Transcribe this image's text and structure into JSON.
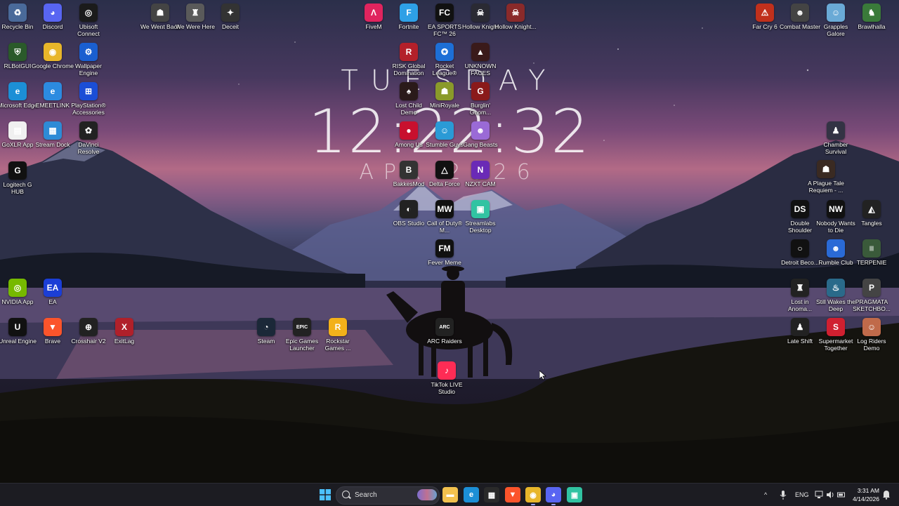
{
  "lock_clock": {
    "day": "TUESDAY",
    "time": "12:22:32",
    "date": "APR 2026"
  },
  "desktop_icons": [
    {
      "label": "Recycle Bin",
      "icon": "recycle-bin-icon",
      "color": "#4a6a9a",
      "glyph": "♻"
    },
    {
      "label": "Discord",
      "icon": "discord-icon",
      "color": "#5865f2",
      "glyph": "◕"
    },
    {
      "label": "Ubisoft Connect",
      "icon": "ubisoft-icon",
      "color": "#1b1b1b",
      "glyph": "◎"
    },
    {
      "label": "We Went Back",
      "icon": "we-went-back-icon",
      "color": "#444",
      "glyph": "☗"
    },
    {
      "label": "We Were Here",
      "icon": "we-were-here-icon",
      "color": "#5a5a5a",
      "glyph": "♜"
    },
    {
      "label": "Deceit",
      "icon": "deceit-icon",
      "color": "#333",
      "glyph": "✦"
    },
    {
      "label": "FiveM",
      "icon": "fivem-icon",
      "color": "#e0245e",
      "glyph": "Λ"
    },
    {
      "label": "Fortnite",
      "icon": "fortnite-icon",
      "color": "#2ea0e6",
      "glyph": "F"
    },
    {
      "label": "EA SPORTS FC™ 26",
      "icon": "ea-fc-icon",
      "color": "#111",
      "glyph": "FC"
    },
    {
      "label": "Hollow Knight",
      "icon": "hollow-knight-icon",
      "color": "#2a2a33",
      "glyph": "☠"
    },
    {
      "label": "Hollow Knight...",
      "icon": "hollow-knight-silksong-icon",
      "color": "#8a2a2a",
      "glyph": "☠"
    },
    {
      "label": "Far Cry 6",
      "icon": "far-cry-icon",
      "color": "#c0301c",
      "glyph": "⚠"
    },
    {
      "label": "Combat Master",
      "icon": "combat-master-icon",
      "color": "#444",
      "glyph": "☻"
    },
    {
      "label": "Grapples Galore",
      "icon": "grapples-galore-icon",
      "color": "#6aaad6",
      "glyph": "☺"
    },
    {
      "label": "Brawlhalla",
      "icon": "brawlhalla-icon",
      "color": "#3a7a3a",
      "glyph": "♞"
    },
    {
      "label": "RLBotGUI",
      "icon": "rlbot-icon",
      "color": "#2a5a2a",
      "glyph": "⛨"
    },
    {
      "label": "Google Chrome",
      "icon": "chrome-icon",
      "color": "#e8b62a",
      "glyph": "◉"
    },
    {
      "label": "Wallpaper Engine",
      "icon": "wallpaper-engine-icon",
      "color": "#1a5fd0",
      "glyph": "⚙"
    },
    {
      "label": "RISK Global Domination",
      "icon": "risk-icon",
      "color": "#b3202a",
      "glyph": "R"
    },
    {
      "label": "Rocket League®",
      "icon": "rocket-league-icon",
      "color": "#1d6fd6",
      "glyph": "✪"
    },
    {
      "label": "UNKNOWN FACES",
      "icon": "unknown-faces-icon",
      "color": "#3a1a1a",
      "glyph": "▲"
    },
    {
      "label": "Microsoft Edge",
      "icon": "edge-icon",
      "color": "#1c8fd6",
      "glyph": "e"
    },
    {
      "label": "EMEETLINK",
      "icon": "emeetlink-icon",
      "color": "#2c8be0",
      "glyph": "e"
    },
    {
      "label": "PlayStation® Accessories",
      "icon": "playstation-icon",
      "color": "#1b4ed6",
      "glyph": "⊞"
    },
    {
      "label": "Lost Child Demo",
      "icon": "lost-child-icon",
      "color": "#2a1a1a",
      "glyph": "♠"
    },
    {
      "label": "MiniRoyale",
      "icon": "miniroyale-icon",
      "color": "#8a9a2a",
      "glyph": "☗"
    },
    {
      "label": "Burglin' Gnom...",
      "icon": "burglin-gnomes-icon",
      "color": "#8a1a1a",
      "glyph": "G"
    },
    {
      "label": "GoXLR App",
      "icon": "goxlr-icon",
      "color": "#f0f0f0",
      "glyph": "▤"
    },
    {
      "label": "Stream Dock",
      "icon": "stream-dock-icon",
      "color": "#2e8bd6",
      "glyph": "▦"
    },
    {
      "label": "DaVinci Resolve",
      "icon": "davinci-icon",
      "color": "#222",
      "glyph": "✿"
    },
    {
      "label": "Among Us",
      "icon": "among-us-icon",
      "color": "#c8102e",
      "glyph": "●"
    },
    {
      "label": "Stumble Guys",
      "icon": "stumble-guys-icon",
      "color": "#2a9ad6",
      "glyph": "☺"
    },
    {
      "label": "Gang Beasts",
      "icon": "gang-beasts-icon",
      "color": "#9a6ad6",
      "glyph": "☻"
    },
    {
      "label": "Chamber Survival",
      "icon": "chamber-survival-icon",
      "color": "#334",
      "glyph": "♟"
    },
    {
      "label": "Logitech G HUB",
      "icon": "logitech-icon",
      "color": "#111",
      "glyph": "G"
    },
    {
      "label": "BakkesMod",
      "icon": "bakkesmod-icon",
      "color": "#333",
      "glyph": "B"
    },
    {
      "label": "Delta Force",
      "icon": "delta-force-icon",
      "color": "#111",
      "glyph": "△"
    },
    {
      "label": "NZXT CAM",
      "icon": "nzxt-icon",
      "color": "#6a2ab6",
      "glyph": "N"
    },
    {
      "label": "A Plague Tale Requiem - ...",
      "icon": "plague-tale-icon",
      "color": "#3a2a22",
      "glyph": "☗"
    },
    {
      "label": "OBS Studio",
      "icon": "obs-icon",
      "color": "#222",
      "glyph": "◐"
    },
    {
      "label": "Call of Duty® M...",
      "icon": "call-of-duty-icon",
      "color": "#111",
      "glyph": "MW"
    },
    {
      "label": "Streamlabs Desktop",
      "icon": "streamlabs-icon",
      "color": "#31c3a2",
      "glyph": "▣"
    },
    {
      "label": "Double Shoulder",
      "icon": "double-shoulder-icon",
      "color": "#111",
      "glyph": "DS"
    },
    {
      "label": "Nobody Wants to Die",
      "icon": "nobody-wants-to-die-icon",
      "color": "#111",
      "glyph": "NW"
    },
    {
      "label": "Tangles",
      "icon": "tangles-icon",
      "color": "#222",
      "glyph": "◭"
    },
    {
      "label": "Fever Meme",
      "icon": "fever-meme-icon",
      "color": "#111",
      "glyph": "FM"
    },
    {
      "label": "Detroit Beco...",
      "icon": "detroit-icon",
      "color": "#111",
      "glyph": "○"
    },
    {
      "label": "Rumble Club",
      "icon": "rumble-club-icon",
      "color": "#2a6ad6",
      "glyph": "☻"
    },
    {
      "label": "TERPENIE",
      "icon": "terpenie-icon",
      "color": "#3a5a3a",
      "glyph": "|||"
    },
    {
      "label": "NVIDIA App",
      "icon": "nvidia-icon",
      "color": "#76b900",
      "glyph": "◎"
    },
    {
      "label": "EA",
      "icon": "ea-icon",
      "color": "#1b3ed6",
      "glyph": "EA"
    },
    {
      "label": "Lost in Anoma...",
      "icon": "lost-in-anomalies-icon",
      "color": "#222",
      "glyph": "♜"
    },
    {
      "label": "Still Wakes the Deep",
      "icon": "still-wakes-icon",
      "color": "#2a6a8a",
      "glyph": "♨"
    },
    {
      "label": "PRAGMATA SKETCHBO...",
      "icon": "pragmata-icon",
      "color": "#444",
      "glyph": "P"
    },
    {
      "label": "Unreal Engine",
      "icon": "unreal-engine-icon",
      "color": "#111",
      "glyph": "U"
    },
    {
      "label": "Brave",
      "icon": "brave-icon",
      "color": "#fb542b",
      "glyph": "▼"
    },
    {
      "label": "Crosshair V2",
      "icon": "crosshair-icon",
      "color": "#222",
      "glyph": "⊕"
    },
    {
      "label": "ExitLag",
      "icon": "exitlag-icon",
      "color": "#b0202a",
      "glyph": "X"
    },
    {
      "label": "Steam",
      "icon": "steam-icon",
      "color": "#1b2838",
      "glyph": "◔"
    },
    {
      "label": "Epic Games Launcher",
      "icon": "epic-games-icon",
      "color": "#222",
      "glyph": "EPIC"
    },
    {
      "label": "Rockstar Games ...",
      "icon": "rockstar-icon",
      "color": "#f3b11a",
      "glyph": "R"
    },
    {
      "label": "ARC Raiders",
      "icon": "arc-raiders-icon",
      "color": "#222",
      "glyph": "ARC"
    },
    {
      "label": "Late Shift",
      "icon": "late-shift-icon",
      "color": "#222",
      "glyph": "♟"
    },
    {
      "label": "Supermarket Together",
      "icon": "supermarket-together-icon",
      "color": "#d02030",
      "glyph": "S"
    },
    {
      "label": "Log Riders Demo",
      "icon": "log-riders-icon",
      "color": "#c06a4a",
      "glyph": "☺"
    },
    {
      "label": "TikTok LIVE Studio",
      "icon": "tiktok-live-icon",
      "color": "#fe2c55",
      "glyph": "♪"
    }
  ],
  "taskbar": {
    "search_placeholder": "Search",
    "pinned": [
      {
        "name": "file-explorer-icon",
        "color": "#f2c14e",
        "glyph": "▬"
      },
      {
        "name": "edge-icon",
        "color": "#1c8fd6",
        "glyph": "e"
      },
      {
        "name": "microsoft-store-icon",
        "color": "#2a2a2a",
        "glyph": "▦"
      },
      {
        "name": "brave-icon",
        "color": "#fb542b",
        "glyph": "▼"
      },
      {
        "name": "chrome-icon",
        "color": "#e8b62a",
        "glyph": "◉"
      },
      {
        "name": "discord-icon",
        "color": "#5865f2",
        "glyph": "◕"
      },
      {
        "name": "streamlabs-icon",
        "color": "#31c3a2",
        "glyph": "▣"
      }
    ],
    "tray": {
      "chevron": "^",
      "language": "ENG",
      "time": "3:31 AM",
      "date": "4/14/2026"
    }
  }
}
